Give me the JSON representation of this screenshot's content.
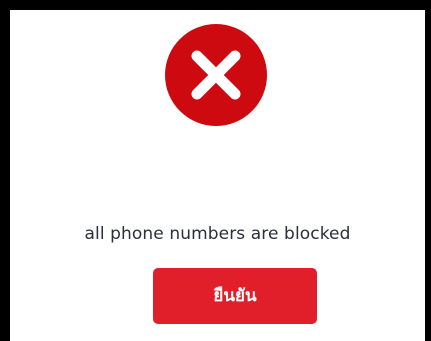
{
  "dialog": {
    "icon": "error-x-icon",
    "message": "all phone numbers are blocked",
    "confirm_label": "ยืนยัน"
  },
  "colors": {
    "icon_red": "#cc0a0f",
    "button_red": "#e01f2a",
    "text": "#2a2f3a",
    "frame": "#000000"
  }
}
